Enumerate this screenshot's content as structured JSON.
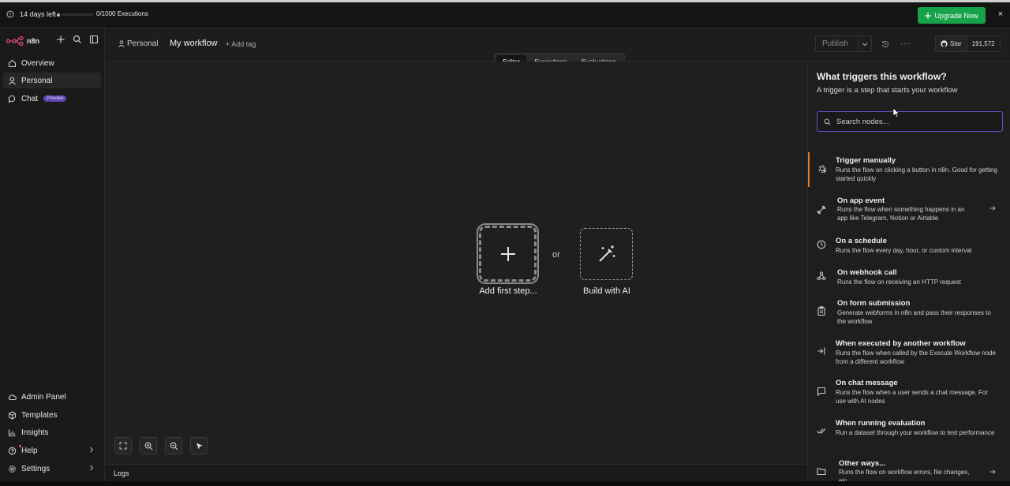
{
  "banner": {
    "days_left": "14 days left",
    "executions": "0/1000 Executions",
    "executions_progress": 0,
    "upgrade_label": "Upgrade Now",
    "close": "×"
  },
  "sidebar": {
    "brand": "n8n",
    "nav": [
      {
        "label": "Overview"
      },
      {
        "label": "Personal"
      },
      {
        "label": "Chat",
        "badge": "Preview"
      }
    ],
    "bottom": [
      {
        "label": "Admin Panel"
      },
      {
        "label": "Templates"
      },
      {
        "label": "Insights"
      },
      {
        "label": "Help"
      },
      {
        "label": "Settings"
      }
    ]
  },
  "header": {
    "project": "Personal",
    "workflow_name": "My workflow",
    "add_tag": "+ Add tag",
    "tabs": [
      {
        "label": "Editor",
        "active": true
      },
      {
        "label": "Executions"
      },
      {
        "label": "Evaluations"
      }
    ],
    "publish": "Publish",
    "github_star": "Star",
    "github_count": "191,572"
  },
  "canvas": {
    "add_first_step": "Add first step...",
    "or": "or",
    "build_with_ai": "Build with AI"
  },
  "logs": {
    "label": "Logs"
  },
  "panel": {
    "title": "What triggers this workflow?",
    "subtitle": "A trigger is a step that starts your workflow",
    "search_placeholder": "Search nodes...",
    "triggers": [
      {
        "title": "Trigger manually",
        "desc": "Runs the flow on clicking a button in n8n. Good for getting started quickly",
        "icon": "cursor-click-icon"
      },
      {
        "title": "On app event",
        "desc": "Runs the flow when something happens in an app like Telegram, Notion or Airtable",
        "icon": "app-event-icon"
      },
      {
        "title": "On a schedule",
        "desc": "Runs the flow every day, hour, or custom interval",
        "icon": "clock-icon"
      },
      {
        "title": "On webhook call",
        "desc": "Runs the flow on receiving an HTTP request",
        "icon": "webhook-icon"
      },
      {
        "title": "On form submission",
        "desc": "Generate webforms in n8n and pass their responses to the workflow",
        "icon": "clipboard-icon"
      },
      {
        "title": "When executed by another workflow",
        "desc": "Runs the flow when called by the Execute Workflow node from a different workflow",
        "icon": "sign-in-icon"
      },
      {
        "title": "On chat message",
        "desc": "Runs the flow when a user sends a chat message. For use with AI nodes",
        "icon": "chat-icon"
      },
      {
        "title": "When running evaluation",
        "desc": "Run a dataset through your workflow to test performance",
        "icon": "check-double-icon"
      },
      {
        "title": "Other ways...",
        "desc": "Runs the flow on workflow errors, file changes, etc.",
        "icon": "folder-icon"
      }
    ]
  },
  "colors": {
    "upgrade": "#17a34a",
    "active_trigger_accent": "#e07a2a",
    "search_border": "#6a4fd0",
    "preview_badge": "#5b45b0"
  }
}
